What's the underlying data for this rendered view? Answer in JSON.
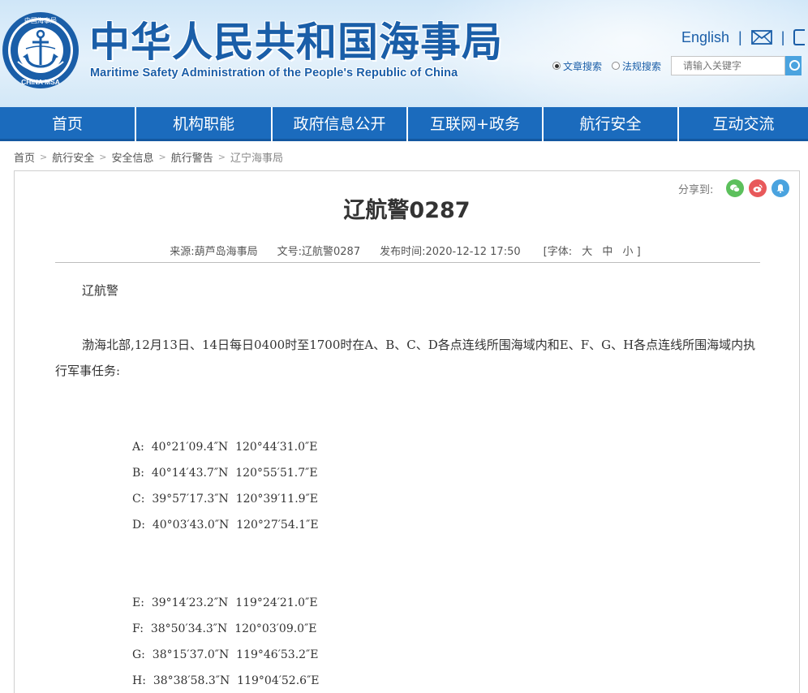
{
  "header": {
    "cn_title": "中华人民共和国海事局",
    "en_title": "Maritime Safety Administration of the People's Republic of China",
    "logo": {
      "ring_top_text": "中国海事局",
      "ring_bottom_text": "CHINA MSA",
      "colors": {
        "outer": "#1a5ea8",
        "inner": "#ffffff"
      }
    },
    "lang_link": "English",
    "separator": "|",
    "icons": [
      "mail-icon",
      "weibo-icon"
    ],
    "search": {
      "options": [
        {
          "label": "文章搜索",
          "selected": true
        },
        {
          "label": "法规搜索",
          "selected": false
        }
      ],
      "placeholder": "请输入关键字"
    }
  },
  "nav": {
    "items": [
      "首页",
      "机构职能",
      "政府信息公开",
      "互联网+政务",
      "航行安全",
      "互动交流"
    ],
    "color": "#1b6bbd"
  },
  "breadcrumb": {
    "items": [
      "首页",
      "航行安全",
      "安全信息",
      "航行警告",
      "辽宁海事局"
    ],
    "separator": ">"
  },
  "article": {
    "share_label": "分享到:",
    "share_icons": [
      {
        "name": "wechat-icon",
        "color": "#5cc05c"
      },
      {
        "name": "weibo-icon",
        "color": "#e8595b"
      },
      {
        "name": "qzone-icon",
        "color": "#4aa3df"
      }
    ],
    "title": "辽航警0287",
    "meta": {
      "source": "来源:葫芦岛海事局",
      "doc_no": "文号:辽航警0287",
      "published": "发布时间:2020-12-12 17:50",
      "font_label": "[字体:",
      "font_large": "大",
      "font_medium": "中",
      "font_small": "小 ]"
    },
    "paragraph1": "辽航警",
    "paragraph2": "渤海北部,12月13日、14日每日0400时至1700时在A、B、C、D各点连线所围海域内和E、F、G、H各点连线所围海域内执行军事任务:",
    "coords_group1": [
      "A:  40°21′09.4″N  120°44′31.0″E",
      "B:  40°14′43.7″N  120°55′51.7″E",
      "C:  39°57′17.3″N  120°39′11.9″E",
      "D:  40°03′43.0″N  120°27′54.1″E"
    ],
    "coords_group2": [
      "E:  39°14′23.2″N  119°24′21.0″E",
      "F:  38°50′34.3″N  120°03′09.0″E",
      "G:  38°15′37.0″N  119°46′53.2″E",
      "H:  38°38′58.3″N  119°04′52.6″E"
    ]
  }
}
